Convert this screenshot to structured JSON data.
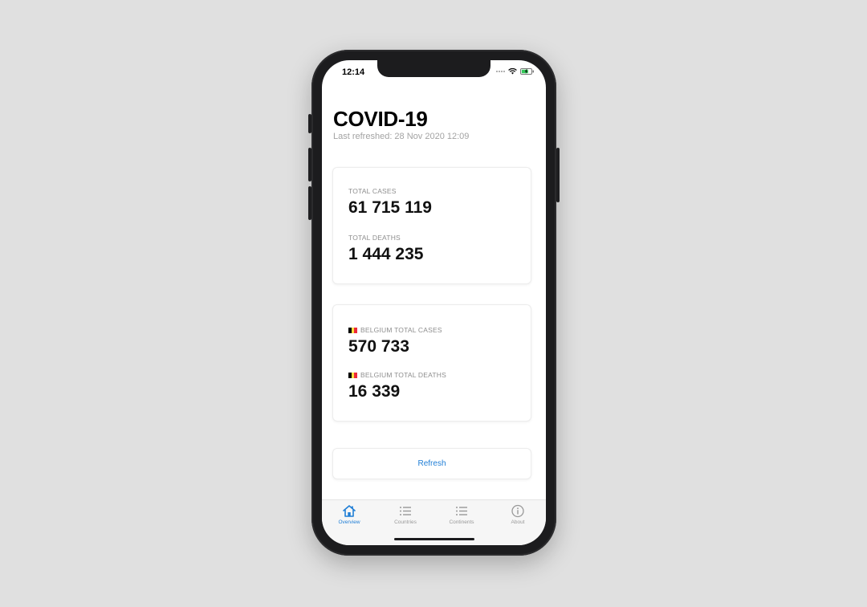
{
  "status_bar": {
    "time": "12:14"
  },
  "header": {
    "title": "COVID-19",
    "subtitle": "Last refreshed: 28 Nov 2020 12:09"
  },
  "world_card": {
    "total_cases_label": "TOTAL CASES",
    "total_cases_value": "61 715 119",
    "total_deaths_label": "TOTAL DEATHS",
    "total_deaths_value": "1 444 235"
  },
  "country_card": {
    "flag_colors": [
      "#000000",
      "#FAE042",
      "#ED2939"
    ],
    "total_cases_label": "BELGIUM TOTAL CASES",
    "total_cases_value": "570 733",
    "total_deaths_label": "BELGIUM TOTAL DEATHS",
    "total_deaths_value": "16 339"
  },
  "refresh_button": {
    "label": "Refresh"
  },
  "tabs": [
    {
      "label": "Overview",
      "icon": "house-icon",
      "active": true
    },
    {
      "label": "Countries",
      "icon": "list-icon",
      "active": false
    },
    {
      "label": "Continents",
      "icon": "list-icon",
      "active": false
    },
    {
      "label": "About",
      "icon": "info-icon",
      "active": false
    }
  ],
  "colors": {
    "accent": "#1f7ed6",
    "inactive_tab": "#999999",
    "background": "#e0e0e0"
  }
}
